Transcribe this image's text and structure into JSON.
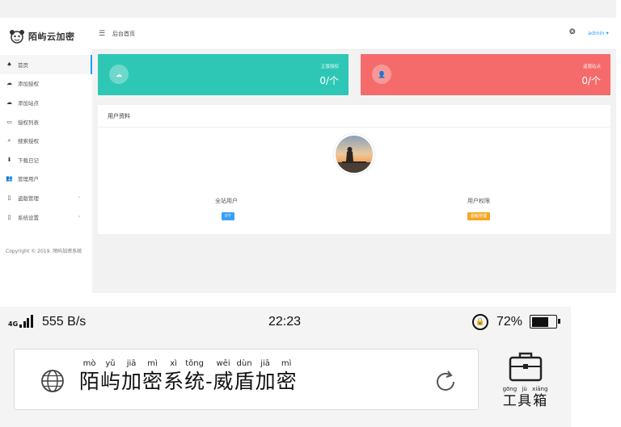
{
  "admin": {
    "logo_text": "陌屿云加密",
    "breadcrumb": "后台首页",
    "username": "admin",
    "menu": [
      {
        "label": "首页",
        "icon": "home-icon",
        "glyph": "♠",
        "active": true,
        "arrow": false
      },
      {
        "label": "添加授权",
        "icon": "cloud-outline-icon",
        "glyph": "☁",
        "active": false,
        "arrow": false
      },
      {
        "label": "添加站点",
        "icon": "cloud-icon",
        "glyph": "☁",
        "active": false,
        "arrow": false
      },
      {
        "label": "授权列表",
        "icon": "monitor-icon",
        "glyph": "▭",
        "active": false,
        "arrow": false
      },
      {
        "label": "搜索授权",
        "icon": "search-icon",
        "glyph": "⌕",
        "active": false,
        "arrow": false
      },
      {
        "label": "下载日记",
        "icon": "download-icon",
        "glyph": "⬇",
        "active": false,
        "arrow": false
      },
      {
        "label": "管理用户",
        "icon": "users-icon",
        "glyph": "👥",
        "active": false,
        "arrow": false
      },
      {
        "label": "盗版管理",
        "icon": "file-icon",
        "glyph": "▯",
        "active": false,
        "arrow": true
      },
      {
        "label": "系统设置",
        "icon": "file-icon",
        "glyph": "▯",
        "active": false,
        "arrow": true
      }
    ],
    "copyright": "Copyright © 2019. 陌屿加密系统",
    "cards": [
      {
        "label": "正版授权",
        "value": "0/个",
        "icon": "cloud-icon"
      },
      {
        "label": "盗版站点",
        "value": "0/个",
        "icon": "user-icon"
      }
    ],
    "profile": {
      "title": "用户资料",
      "stat_left_label": "全站用户",
      "stat_left_badge": "0个",
      "stat_right_label": "用户权限",
      "stat_right_badge": "超级管理"
    }
  },
  "phone": {
    "network": "4G",
    "speed": "555  B/s",
    "time": "22:23",
    "battery_pct_text": "72%",
    "battery_level": 0.72
  },
  "browser": {
    "page_title_chars": [
      {
        "py": "mò",
        "hz": "陌"
      },
      {
        "py": "yǔ",
        "hz": "屿"
      },
      {
        "py": "jiā",
        "hz": "加"
      },
      {
        "py": "mì",
        "hz": "密"
      },
      {
        "py": "xì",
        "hz": "系"
      },
      {
        "py": "tǒng",
        "hz": "统"
      },
      {
        "py": "",
        "hz": "-"
      },
      {
        "py": "wēi",
        "hz": "威"
      },
      {
        "py": "dùn",
        "hz": "盾"
      },
      {
        "py": "jiā",
        "hz": "加"
      },
      {
        "py": "mì",
        "hz": "密"
      }
    ],
    "toolbox_chars": [
      {
        "py": "gōng",
        "hz": "工"
      },
      {
        "py": "jù",
        "hz": "具"
      },
      {
        "py": "xiāng",
        "hz": "箱"
      }
    ]
  },
  "colors": {
    "teal": "#2ec7b5",
    "red": "#f56b6b",
    "blue": "#1e9fff",
    "orange": "#f5a623"
  }
}
